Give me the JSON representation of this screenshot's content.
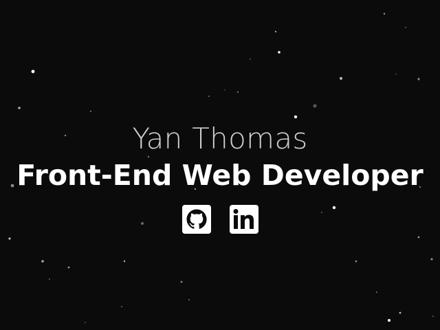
{
  "hero": {
    "name": "Yan Thomas",
    "role": "Front-End Web Developer"
  },
  "social": [
    {
      "name": "github",
      "icon": "github-icon"
    },
    {
      "name": "linkedin",
      "icon": "linkedin-icon"
    }
  ],
  "colors": {
    "background": "#0b0b0c",
    "name_text": "#cfcfcf",
    "role_text": "#ffffff",
    "icon_bg": "#ffffff",
    "icon_glyph": "#0b0b0c",
    "star": "#ffffff"
  }
}
